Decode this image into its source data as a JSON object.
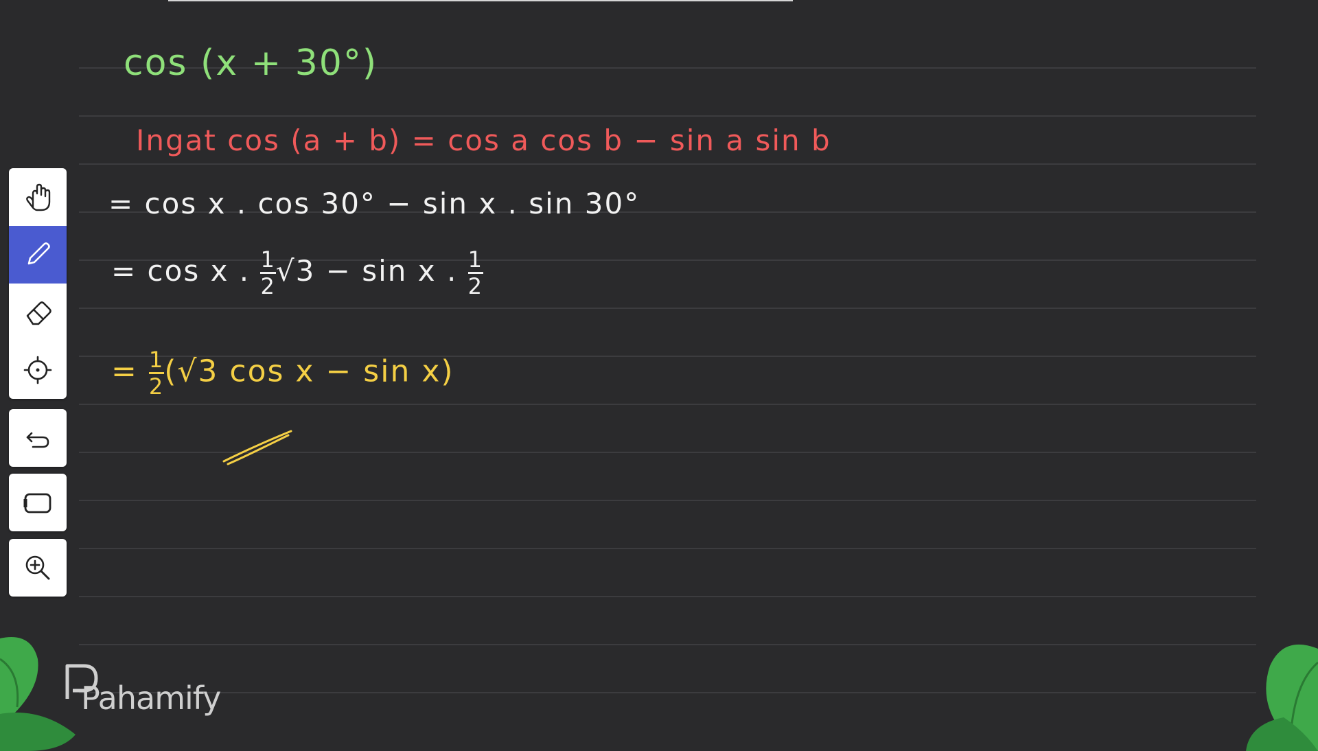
{
  "lines": {
    "line1": "cos (x + 30°)",
    "line2": "Ingat cos (a + b) = cos a cos b − sin a sin b",
    "line3": "= cos x . cos 30° − sin x . sin 30°",
    "line4_start": "= cos x . ",
    "line4_frac_num": "1",
    "line4_frac_den": "2",
    "line4_mid": "√3  − sin x . ",
    "line4_frac2_num": "1",
    "line4_frac2_den": "2",
    "line5_start": "= ",
    "line5_frac_num": "1",
    "line5_frac_den": "2",
    "line5_rest": "(√3 cos x − sin x)"
  },
  "toolbar": {
    "tools": [
      "hand-icon",
      "pen-icon",
      "eraser-icon",
      "laser-pointer-icon",
      "undo-icon",
      "shape-icon",
      "zoom-in-icon"
    ],
    "active": "pen-icon"
  },
  "brand": {
    "name": "Pahamify"
  },
  "colors": {
    "background": "#2a2a2c",
    "green": "#8fe07a",
    "red": "#f05a5a",
    "white": "#f2f2f2",
    "yellow": "#f4cf45",
    "accent": "#4a5bd0",
    "leaf": "#3fa94a"
  }
}
